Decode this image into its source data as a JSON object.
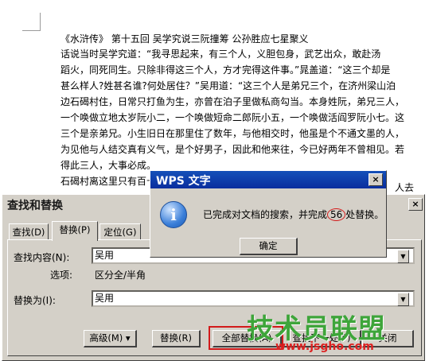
{
  "document": {
    "title": "《水浒传》  第十五回 吴学究说三阮撞筹  公孙胜应七星聚义",
    "lines": [
      "话说当时吴学究道：“我寻思起来，有三个人，义胆包身，武艺出众，敢赴汤",
      "蹈火，同死同生。只除非得这三个人，方才完得这件事。”晁盖道：“这三个却是",
      "甚么样人?姓甚名谁?何处居住？”吴用道：“这三个人是弟兄三个，在济州梁山泊",
      "边石碣村住，日常只打鱼为生，亦曾在泊子里做私商勾当。本身姓阮，弟兄三人，",
      "一个唤做立地太岁阮小二，一个唤做短命二郎阮小五，一个唤做活阎罗阮小七。这",
      "三个是亲弟兄。小生旧日在那里住了数年，与他相交时，他虽是个不通文墨的人，",
      "为见他与人结交真有义气，是个好男子，因此和他来往，今已好两年不曾相见。若",
      "得此三人，大事必成。",
      "石碣村离这里只有百十",
      "人去"
    ]
  },
  "find_replace": {
    "title": "查找和替换",
    "close_label": "×",
    "tabs": [
      "查找(D)",
      "替换(P)",
      "定位(G)"
    ],
    "find_label": "查找内容(N):",
    "find_value": "吴用",
    "options_label": "选项:",
    "options_value": "区分全/半角",
    "replace_label": "替换为(I):",
    "replace_value": "吴用",
    "buttons": {
      "advanced": "高级(M) ▾",
      "replace": "替换(R)",
      "replace_all": "全部替换(A)",
      "find_next": "查找下一处(F)",
      "close": "关闭"
    }
  },
  "message_box": {
    "title": "WPS 文字",
    "close_label": "×",
    "icon": "info-icon",
    "icon_glyph": "i",
    "message_before": "已完成对文档的搜索，并完成",
    "count": "56",
    "message_after": "处替换。",
    "ok_label": "确定"
  },
  "watermark": {
    "brand": "技术员联盟",
    "url": "www.jsgho.com"
  },
  "colors": {
    "dialog_bg": "#d4d0c8",
    "title_bar": "#0a2e9e",
    "highlight": "#d21a1a",
    "watermark_green": "#3ea53a"
  }
}
